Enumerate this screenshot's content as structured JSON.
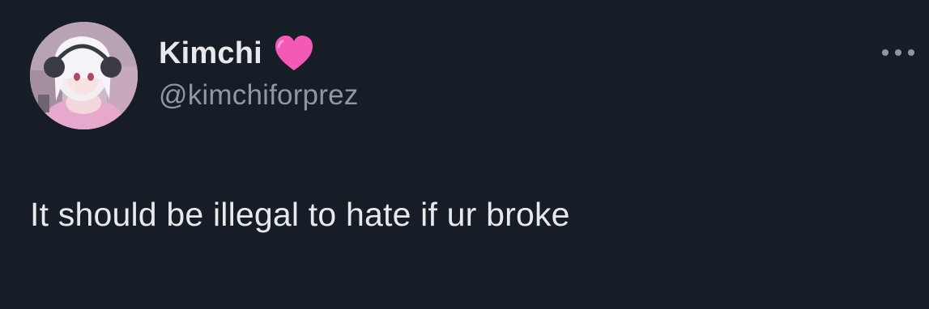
{
  "tweet": {
    "author": {
      "display_name": "Kimchi",
      "badge_emoji": "pink-heart",
      "handle": "@kimchiforprez"
    },
    "text": "It should be illegal to hate if ur broke",
    "more_icon": "more-options-icon"
  },
  "colors": {
    "background": "#171d26",
    "primary_text": "#e7e9ea",
    "secondary_text": "#8b98a5",
    "heart": "#f25ab6"
  }
}
